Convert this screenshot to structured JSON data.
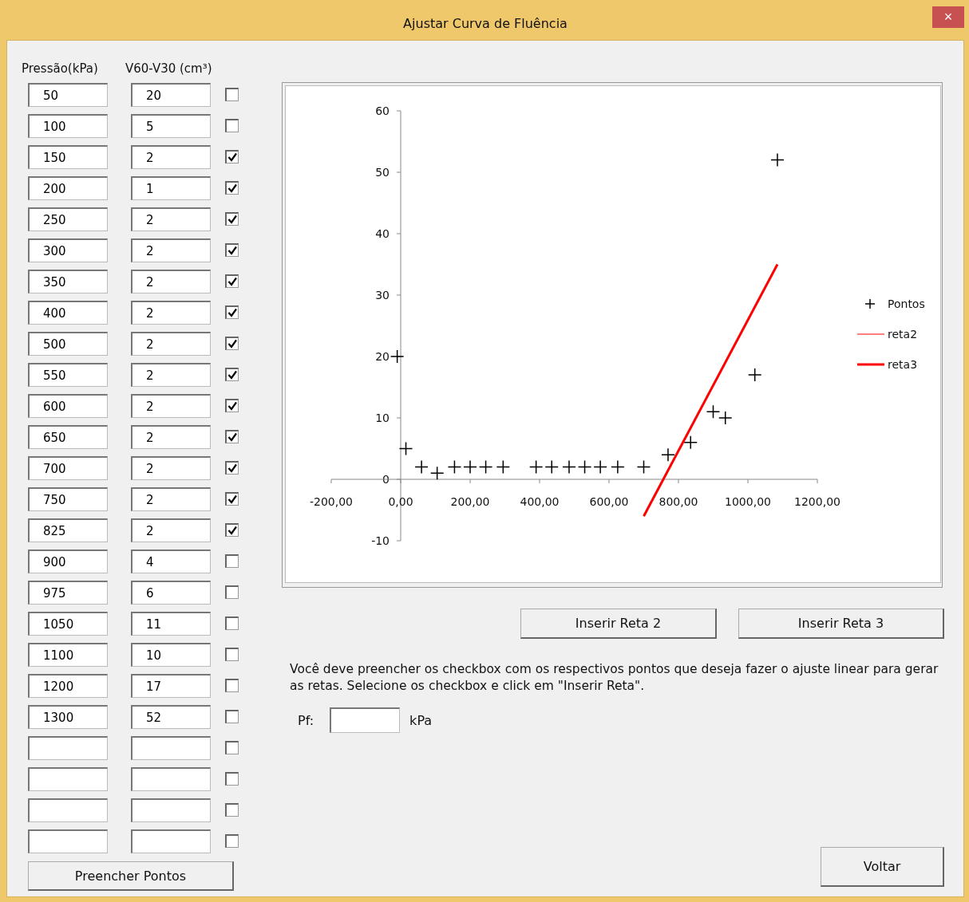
{
  "window": {
    "title": "Ajustar Curva de Fluência",
    "close": "×"
  },
  "columns": [
    "Pressão(kPa)",
    "V60-V30 (cm³)"
  ],
  "rows": [
    {
      "pressure": "50",
      "volume": "20",
      "checked": false
    },
    {
      "pressure": "100",
      "volume": "5",
      "checked": false
    },
    {
      "pressure": "150",
      "volume": "2",
      "checked": true
    },
    {
      "pressure": "200",
      "volume": "1",
      "checked": true
    },
    {
      "pressure": "250",
      "volume": "2",
      "checked": true
    },
    {
      "pressure": "300",
      "volume": "2",
      "checked": true
    },
    {
      "pressure": "350",
      "volume": "2",
      "checked": true
    },
    {
      "pressure": "400",
      "volume": "2",
      "checked": true
    },
    {
      "pressure": "500",
      "volume": "2",
      "checked": true
    },
    {
      "pressure": "550",
      "volume": "2",
      "checked": true
    },
    {
      "pressure": "600",
      "volume": "2",
      "checked": true
    },
    {
      "pressure": "650",
      "volume": "2",
      "checked": true
    },
    {
      "pressure": "700",
      "volume": "2",
      "checked": true
    },
    {
      "pressure": "750",
      "volume": "2",
      "checked": true
    },
    {
      "pressure": "825",
      "volume": "2",
      "checked": true
    },
    {
      "pressure": "900",
      "volume": "4",
      "checked": false
    },
    {
      "pressure": "975",
      "volume": "6",
      "checked": false
    },
    {
      "pressure": "1050",
      "volume": "11",
      "checked": false
    },
    {
      "pressure": "1100",
      "volume": "10",
      "checked": false
    },
    {
      "pressure": "1200",
      "volume": "17",
      "checked": false
    },
    {
      "pressure": "1300",
      "volume": "52",
      "checked": false
    },
    {
      "checked": false
    },
    {
      "checked": false
    },
    {
      "checked": false
    },
    {
      "checked": false
    }
  ],
  "fill_button": "Preencher Pontos",
  "chart_data": {
    "type": "scatter",
    "legend": "right",
    "xlim": [
      -200,
      1200
    ],
    "ylim": [
      -10,
      60
    ],
    "xticks": [
      {
        "value": -200,
        "label": "-200,00"
      },
      {
        "value": 0,
        "label": "0,00"
      },
      {
        "value": 200,
        "label": "200,00"
      },
      {
        "value": 400,
        "label": "400,00"
      },
      {
        "value": 600,
        "label": "600,00"
      },
      {
        "value": 800,
        "label": "800,00"
      },
      {
        "value": 1000,
        "label": "1000,00"
      },
      {
        "value": 1200,
        "label": "1200,00"
      }
    ],
    "yticks": [
      {
        "value": -10,
        "label": "-10"
      },
      {
        "value": 0,
        "label": "0"
      },
      {
        "value": 10,
        "label": "10"
      },
      {
        "value": 20,
        "label": "20"
      },
      {
        "value": 30,
        "label": "30"
      },
      {
        "value": 40,
        "label": "40"
      },
      {
        "value": 50,
        "label": "50"
      },
      {
        "value": 60,
        "label": "60"
      }
    ],
    "series": [
      {
        "name": "Pontos",
        "type": "scatter",
        "color": "#000000",
        "x": [
          -10,
          15,
          60,
          105,
          155,
          200,
          245,
          295,
          390,
          435,
          485,
          530,
          575,
          625,
          700,
          770,
          835,
          900,
          935,
          1020,
          1085
        ],
        "values": [
          20,
          5,
          2,
          1,
          2,
          2,
          2,
          2,
          2,
          2,
          2,
          2,
          2,
          2,
          2,
          4,
          6,
          11,
          10,
          17,
          52
        ]
      },
      {
        "name": "reta2",
        "type": "line",
        "color": "#ff0000"
      },
      {
        "name": "reta3",
        "type": "line",
        "color": "#ff0000",
        "x": [
          700,
          1085
        ],
        "values": [
          -6,
          35
        ]
      }
    ]
  },
  "buttons": [
    "Inserir Reta 2",
    "Inserir Reta 3"
  ],
  "instructions": "Você deve preencher os checkbox com os respectivos pontos que deseja fazer o ajuste linear para gerar as retas. Selecione os checkbox e click em \"Inserir Reta\".",
  "pf": {
    "label": "Pf:",
    "unit": "kPa"
  },
  "back_button": "Voltar"
}
